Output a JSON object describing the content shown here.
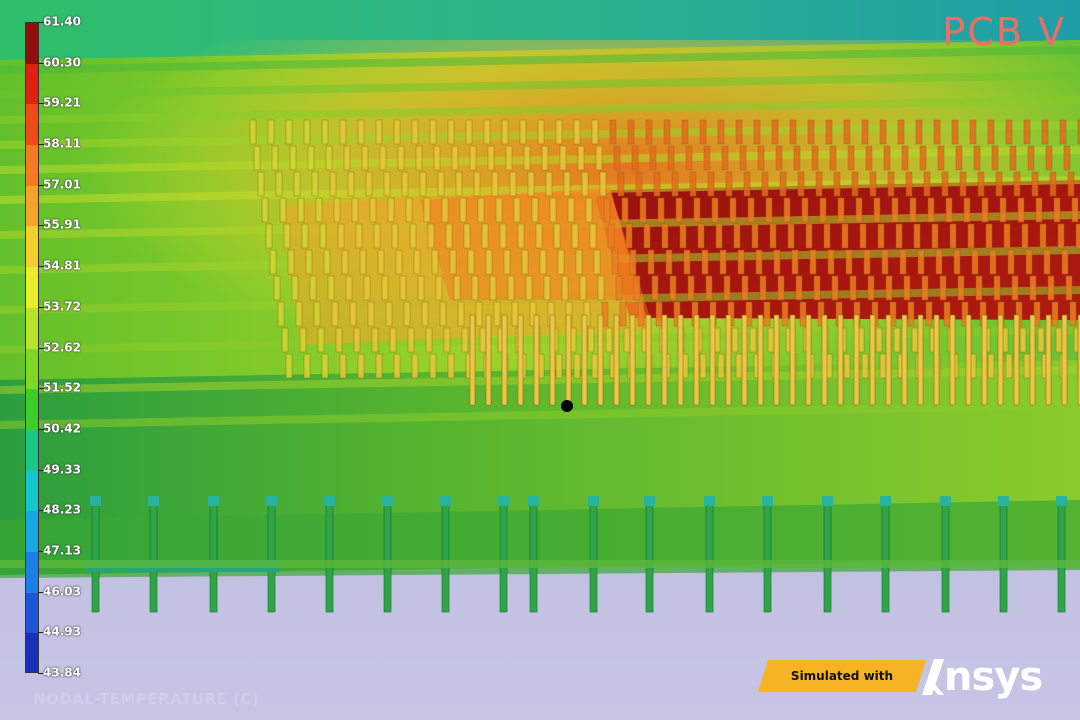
{
  "scene": {
    "palette": {
      "background_bottom": "#bdbbe0",
      "board_green": "#6cc12a",
      "chip_hot": "#a5100c",
      "pin_orange": "#f07a1c",
      "pin_yellow": "#e8c830",
      "cool_teal": "#20b070"
    }
  },
  "watermark": {
    "text": "PCB V"
  },
  "legend": {
    "title": "NODAL-TEMPERATURE (C)",
    "values": [
      "61.40",
      "60.30",
      "59.21",
      "58.11",
      "57.01",
      "55.91",
      "54.81",
      "53.72",
      "52.62",
      "51.52",
      "50.42",
      "49.33",
      "48.23",
      "47.13",
      "46.03",
      "44.93",
      "43.84"
    ],
    "colors": [
      "#8f0f0c",
      "#e02010",
      "#ef4a18",
      "#f67a24",
      "#f6a32a",
      "#f4cf2c",
      "#e8ee28",
      "#b8e42a",
      "#7ed824",
      "#3ccd26",
      "#1cc684",
      "#16c6ce",
      "#17a8e4",
      "#1a80e4",
      "#1c55d8",
      "#1a2fb8",
      "#0c0e74"
    ]
  },
  "badge": {
    "label": "Simulated with"
  },
  "brand": {
    "name": "nsys",
    "icon": "ansys-a-logo-icon"
  },
  "cursor": {
    "icon": "pointer-dot-icon"
  }
}
